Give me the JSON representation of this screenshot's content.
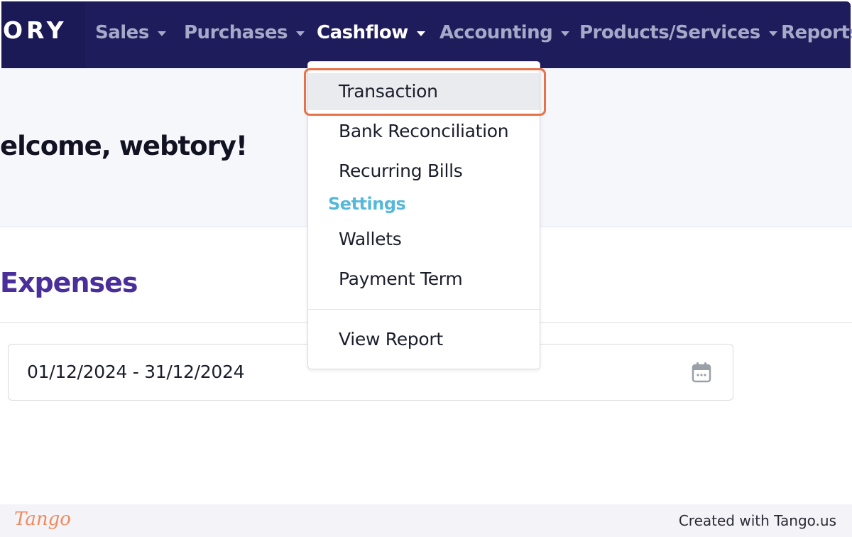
{
  "navbar": {
    "brand": "ORY",
    "items": [
      {
        "label": "Sales"
      },
      {
        "label": "Purchases"
      },
      {
        "label": "Cashflow"
      },
      {
        "label": "Accounting"
      },
      {
        "label": "Products/Services"
      },
      {
        "label": "Reports"
      }
    ],
    "active": "Cashflow",
    "background": "#1f1c5c"
  },
  "dropdown": {
    "items": [
      {
        "label": "Transaction",
        "highlighted": true
      },
      {
        "label": "Bank Reconciliation"
      },
      {
        "label": "Recurring Bills"
      }
    ],
    "settings_header": "Settings",
    "settings_items": [
      {
        "label": "Wallets"
      },
      {
        "label": "Payment Term"
      }
    ],
    "report_item": "View Report",
    "highlight_color": "#e9714a",
    "header_color": "#55b8db"
  },
  "welcome": {
    "text": "elcome, webtory!"
  },
  "expenses": {
    "title": "Expenses",
    "date_range": "01/12/2024 - 31/12/2024",
    "calendar_icon": "calendar-icon",
    "title_color": "#4a2f9a"
  },
  "footer": {
    "logo": "Tango",
    "text": "Created with Tango.us"
  }
}
